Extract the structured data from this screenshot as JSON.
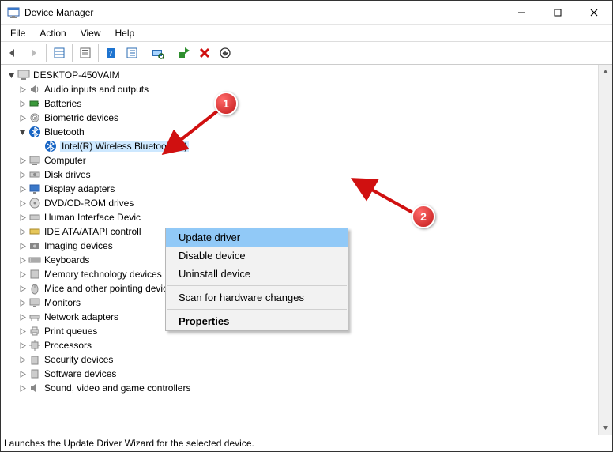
{
  "window": {
    "title": "Device Manager"
  },
  "menu": {
    "file": "File",
    "action": "Action",
    "view": "View",
    "help": "Help"
  },
  "tree": {
    "root": "DESKTOP-450VAIM",
    "nodes": [
      {
        "label": "Audio inputs and outputs"
      },
      {
        "label": "Batteries"
      },
      {
        "label": "Biometric devices"
      },
      {
        "label": "Bluetooth",
        "expanded": true,
        "child": "Intel(R) Wireless Bluetooth(R)"
      },
      {
        "label": "Computer"
      },
      {
        "label": "Disk drives"
      },
      {
        "label": "Display adapters"
      },
      {
        "label": "DVD/CD-ROM drives"
      },
      {
        "label": "Human Interface Devic"
      },
      {
        "label": "IDE ATA/ATAPI controll"
      },
      {
        "label": "Imaging devices"
      },
      {
        "label": "Keyboards"
      },
      {
        "label": "Memory technology devices"
      },
      {
        "label": "Mice and other pointing devices"
      },
      {
        "label": "Monitors"
      },
      {
        "label": "Network adapters"
      },
      {
        "label": "Print queues"
      },
      {
        "label": "Processors"
      },
      {
        "label": "Security devices"
      },
      {
        "label": "Software devices"
      },
      {
        "label": "Sound, video and game controllers"
      }
    ]
  },
  "context": {
    "update": "Update driver",
    "disable": "Disable device",
    "uninstall": "Uninstall device",
    "scan": "Scan for hardware changes",
    "properties": "Properties"
  },
  "annotations": {
    "one": "1",
    "two": "2"
  },
  "status": "Launches the Update Driver Wizard for the selected device."
}
